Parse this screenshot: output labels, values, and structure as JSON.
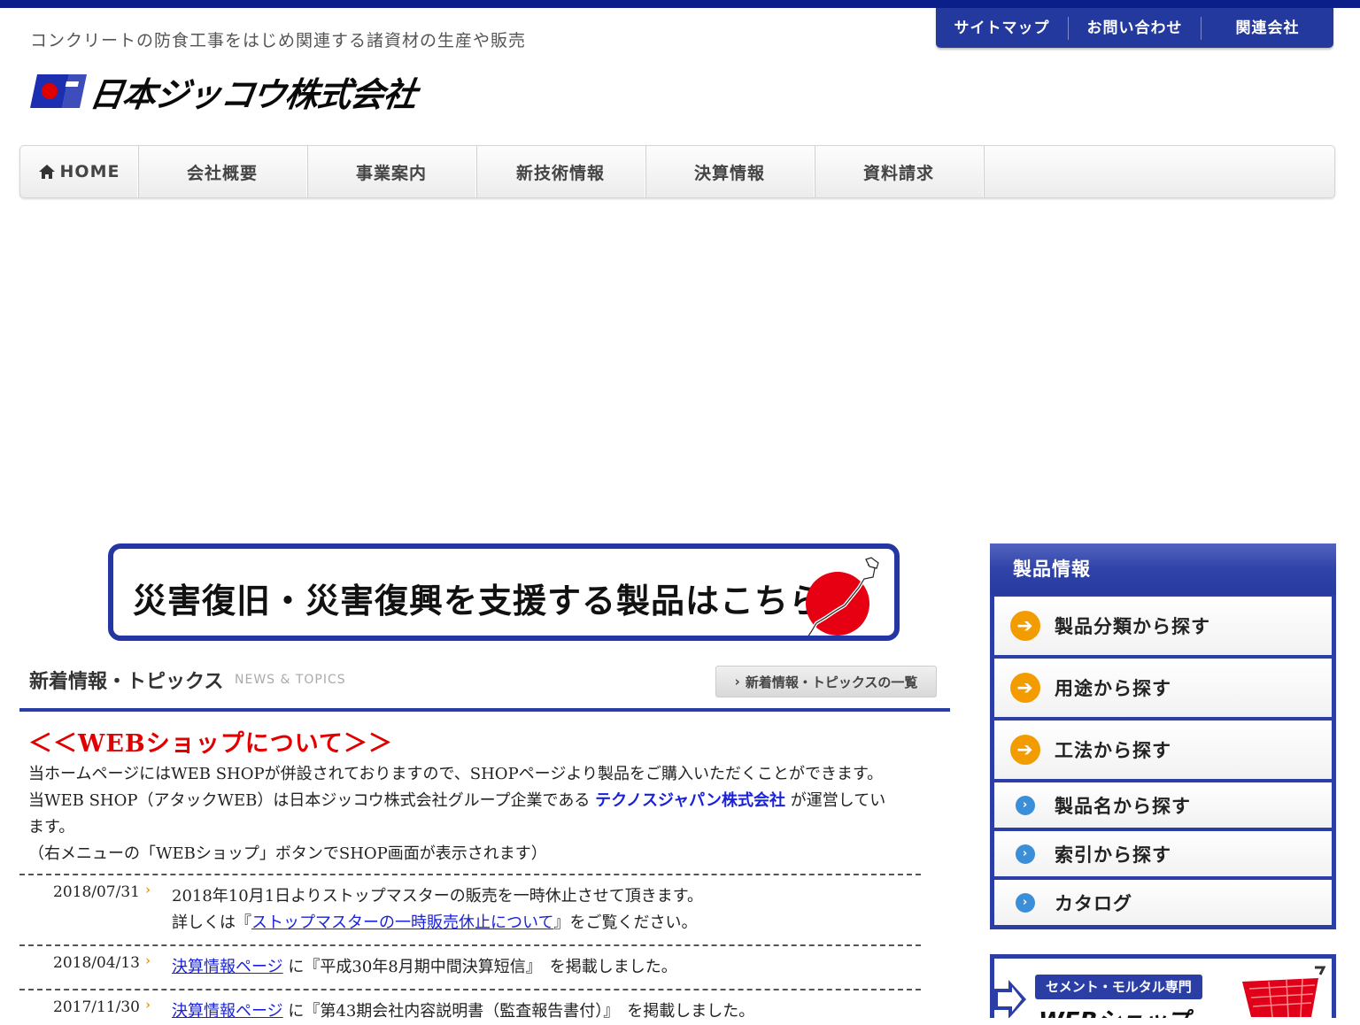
{
  "header": {
    "tagline": "コンクリートの防食工事をはじめ関連する諸資材の生産や販売",
    "company_name": "日本ジッコウ株式会社",
    "utility_nav": [
      "サイトマップ",
      "お問い合わせ",
      "関連会社"
    ]
  },
  "global_nav": {
    "home": "HOME",
    "items": [
      "会社概要",
      "事業案内",
      "新技術情報",
      "決算情報",
      "資料請求"
    ]
  },
  "banner": {
    "text": "災害復旧・災害復興を支援する製品はこちら"
  },
  "news": {
    "title": "新着情報・トピックス",
    "subtitle": "NEWS & TOPICS",
    "list_button": "新着情報・トピックスの一覧",
    "web_heading": "＜＜WEBショップについて＞＞",
    "web_para": {
      "line1": "当ホームページにはWEB SHOPが併設されておりますので、SHOPページより製品をご購入いただくことができます。",
      "line2_a": "当WEB SHOP（アタックWEB）は日本ジッコウ株式会社グループ企業である",
      "line2_link": "テクノスジャパン株式会社",
      "line2_b": "が運営してい",
      "line3": "ます。",
      "line4": "（右メニューの「WEBショップ」ボタンでSHOP画面が表示されます）"
    },
    "items": [
      {
        "date": "2018/07/31",
        "text1": "2018年10月1日よりストップマスターの販売を一時休止させて頂きます。",
        "text2_a": "詳しくは『",
        "text2_link": "ストップマスターの一時販売休止について",
        "text2_b": "』をご覧ください。"
      },
      {
        "date": "2018/04/13",
        "link": "決算情報ページ",
        "text": "に『平成30年8月期中間決算短信』　を掲載しました。"
      },
      {
        "date": "2017/11/30",
        "link": "決算情報ページ",
        "text": "に『第43期会社内容説明書（監査報告書付）』　を掲載しました。"
      }
    ]
  },
  "sidebar": {
    "title": "製品情報",
    "items": [
      "製品分類から探す",
      "用途から探す",
      "工法から探す",
      "製品名から探す",
      "索引から探す",
      "カタログ"
    ],
    "shop_badge": "セメント・モルタル専門",
    "shop_title": "WEBショップ"
  },
  "colors": {
    "brand_navy": "#2a3ea6",
    "accent_orange": "#f39c00",
    "heading_red": "#e10000",
    "link_blue": "#1a22d6"
  }
}
